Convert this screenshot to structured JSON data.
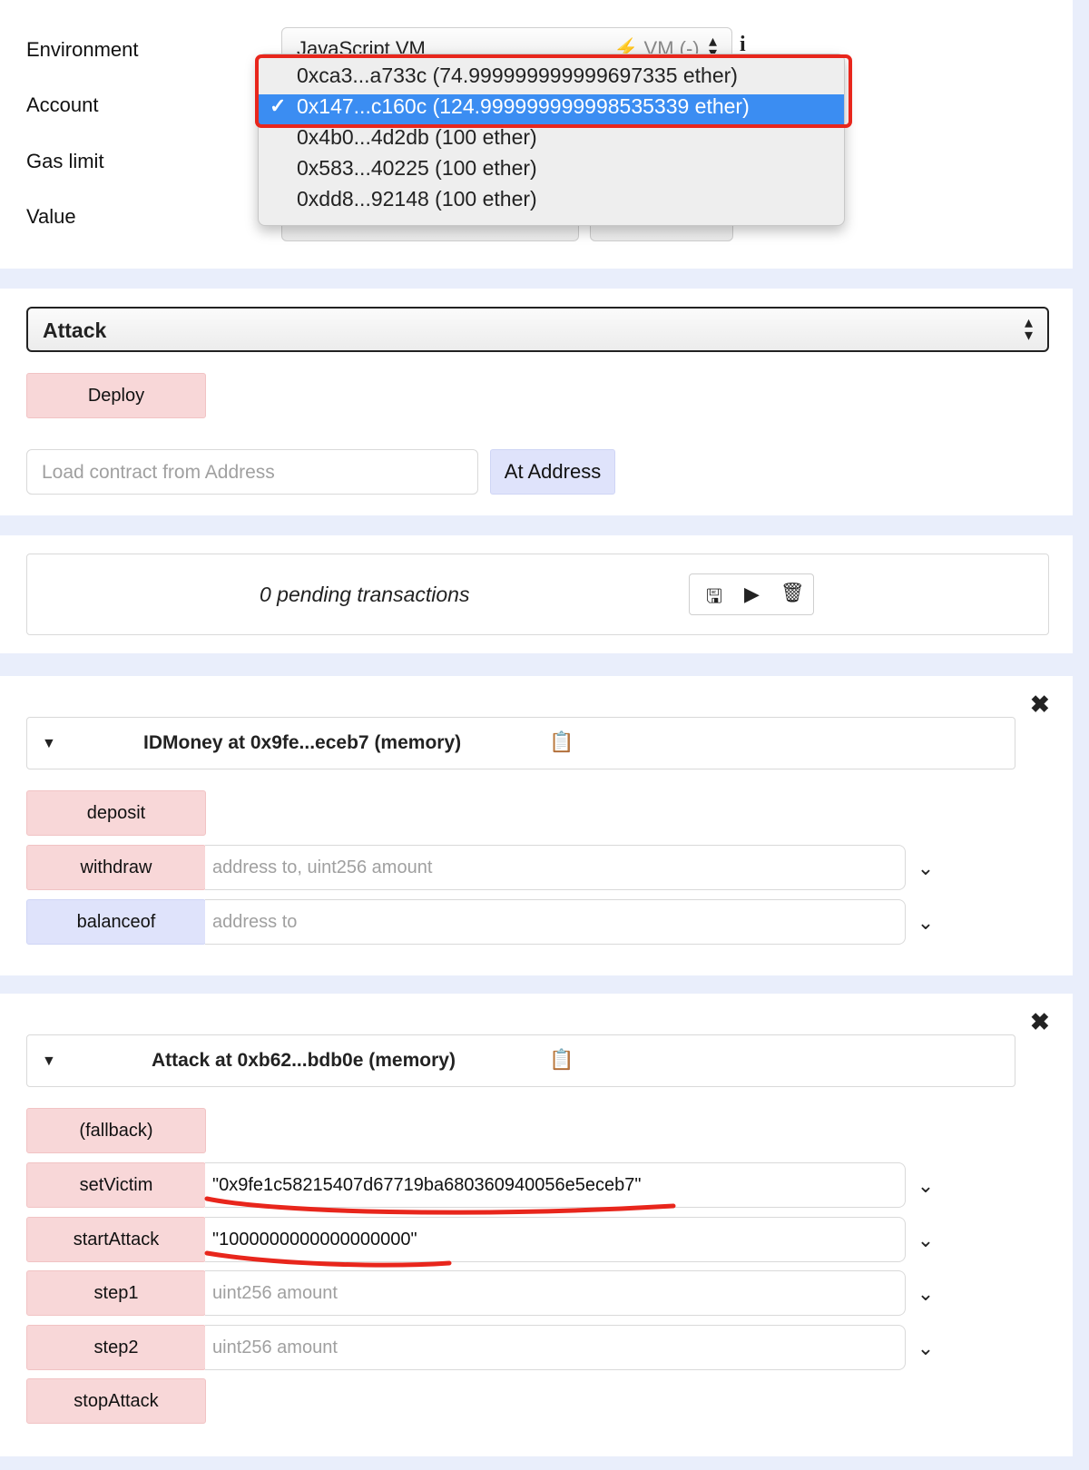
{
  "settings": {
    "environment_label": "Environment",
    "account_label": "Account",
    "gas_limit_label": "Gas limit",
    "value_label": "Value",
    "environment_value": "JavaScript VM",
    "environment_network": "VM (-)",
    "info_icon": "i",
    "account_options": [
      {
        "label": "0xca3...a733c (74.999999999999697335 ether)",
        "selected": false
      },
      {
        "label": "0x147...c160c (124.999999999998535339 ether)",
        "selected": true
      },
      {
        "label": "0x4b0...4d2db (100 ether)",
        "selected": false
      },
      {
        "label": "0x583...40225 (100 ether)",
        "selected": false
      },
      {
        "label": "0xdd8...92148 (100 ether)",
        "selected": false
      }
    ],
    "checkmark": "✓"
  },
  "deploy": {
    "contract_selected": "Attack",
    "deploy_label": "Deploy",
    "address_placeholder": "Load contract from Address",
    "at_address_label": "At Address"
  },
  "transactions": {
    "pending_text": "0 pending transactions"
  },
  "contracts": [
    {
      "title": "IDMoney at 0x9fe...eceb7 (memory)",
      "functions": [
        {
          "label": "deposit",
          "type": "red",
          "input": null
        },
        {
          "label": "withdraw",
          "type": "red",
          "input": {
            "value": "",
            "placeholder": "address to, uint256 amount"
          }
        },
        {
          "label": "balanceof",
          "type": "blue",
          "input": {
            "value": "",
            "placeholder": "address to"
          }
        }
      ]
    },
    {
      "title": "Attack at 0xb62...bdb0e (memory)",
      "functions": [
        {
          "label": "(fallback)",
          "type": "red",
          "input": null
        },
        {
          "label": "setVictim",
          "type": "red",
          "input": {
            "value": "\"0x9fe1c58215407d67719ba680360940056e5eceb7\"",
            "placeholder": ""
          }
        },
        {
          "label": "startAttack",
          "type": "red",
          "input": {
            "value": "\"1000000000000000000\"",
            "placeholder": ""
          }
        },
        {
          "label": "step1",
          "type": "red",
          "input": {
            "value": "",
            "placeholder": "uint256 amount"
          }
        },
        {
          "label": "step2",
          "type": "red",
          "input": {
            "value": "",
            "placeholder": "uint256 amount"
          }
        },
        {
          "label": "stopAttack",
          "type": "red",
          "input": null
        }
      ]
    }
  ],
  "colors": {
    "highlight": "#3b8df2",
    "annotation_red": "#e8261c",
    "button_red": "#f8d7d8",
    "button_blue": "#dfe3fb",
    "background": "#e9eefb"
  }
}
